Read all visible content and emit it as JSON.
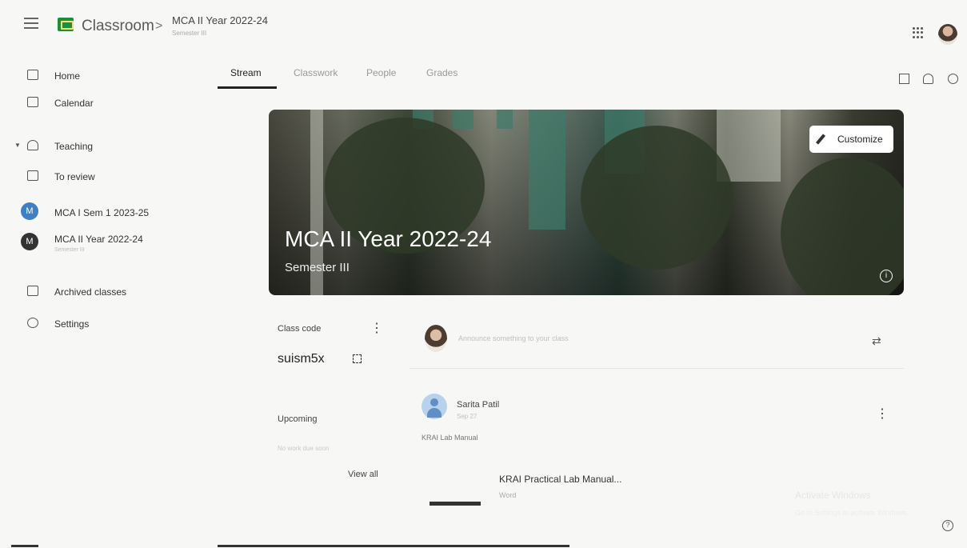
{
  "topbar": {
    "app_name": "Classroom",
    "breadcrumb_sep": ">",
    "class_title": "MCA II Year 2022-24",
    "class_section": "Semester III"
  },
  "sidebar": {
    "items": [
      {
        "label": "Home",
        "icon": "home-icon"
      },
      {
        "label": "Calendar",
        "icon": "calendar-icon"
      },
      {
        "label": "Teaching",
        "icon": "teaching-icon"
      },
      {
        "label": "To review",
        "icon": "review-icon"
      },
      {
        "label": "MCA I Sem 1 2023-25",
        "initial": "M",
        "color": "#3f7fc4"
      },
      {
        "label": "MCA II Year 2022-24",
        "sub": "Semester III",
        "initial": "M",
        "color": "#333333"
      },
      {
        "label": "Archived classes",
        "icon": "archive-icon"
      },
      {
        "label": "Settings",
        "icon": "gear-icon"
      }
    ]
  },
  "tabs": [
    "Stream",
    "Classwork",
    "People",
    "Grades"
  ],
  "active_tab": "Stream",
  "banner": {
    "title": "MCA II Year 2022-24",
    "subtitle": "Semester III",
    "customize_label": "Customize",
    "info": "i"
  },
  "class_code": {
    "label": "Class code",
    "value": "suism5x"
  },
  "upcoming": {
    "label": "Upcoming",
    "empty_text": "No work due soon",
    "view_all": "View all"
  },
  "announce": {
    "placeholder": "Announce something to your class"
  },
  "post": {
    "author": "Sarita Patil",
    "date": "Sep 27",
    "text": "KRAI Lab Manual",
    "attachment_title": "KRAI Practical Lab Manual...",
    "attachment_type": "Word"
  },
  "watermark": {
    "line1": "Activate Windows",
    "line2": "Go to Settings to activate Windows."
  },
  "help": "?"
}
